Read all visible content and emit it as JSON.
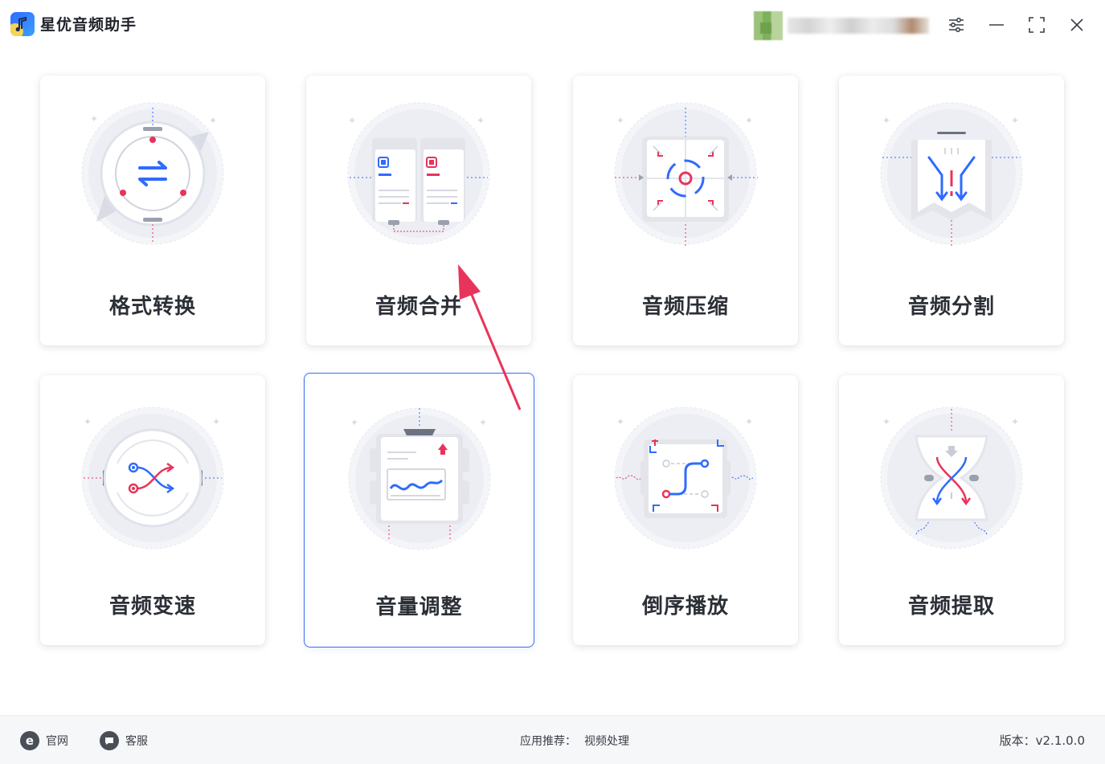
{
  "app": {
    "title": "星优音频助手"
  },
  "cards": [
    {
      "label": "格式转换"
    },
    {
      "label": "音频合并"
    },
    {
      "label": "音频压缩"
    },
    {
      "label": "音频分割"
    },
    {
      "label": "音频变速"
    },
    {
      "label": "音量调整"
    },
    {
      "label": "倒序播放"
    },
    {
      "label": "音频提取"
    }
  ],
  "footer": {
    "site_label": "官网",
    "service_label": "客服",
    "recommend_label": "应用推荐：",
    "recommend_link": "视频处理",
    "version": "版本：v2.1.0.0"
  },
  "colors": {
    "accent_blue": "#2f6bff",
    "accent_red": "#e8345a",
    "selected_border": "#3b6ef5"
  }
}
